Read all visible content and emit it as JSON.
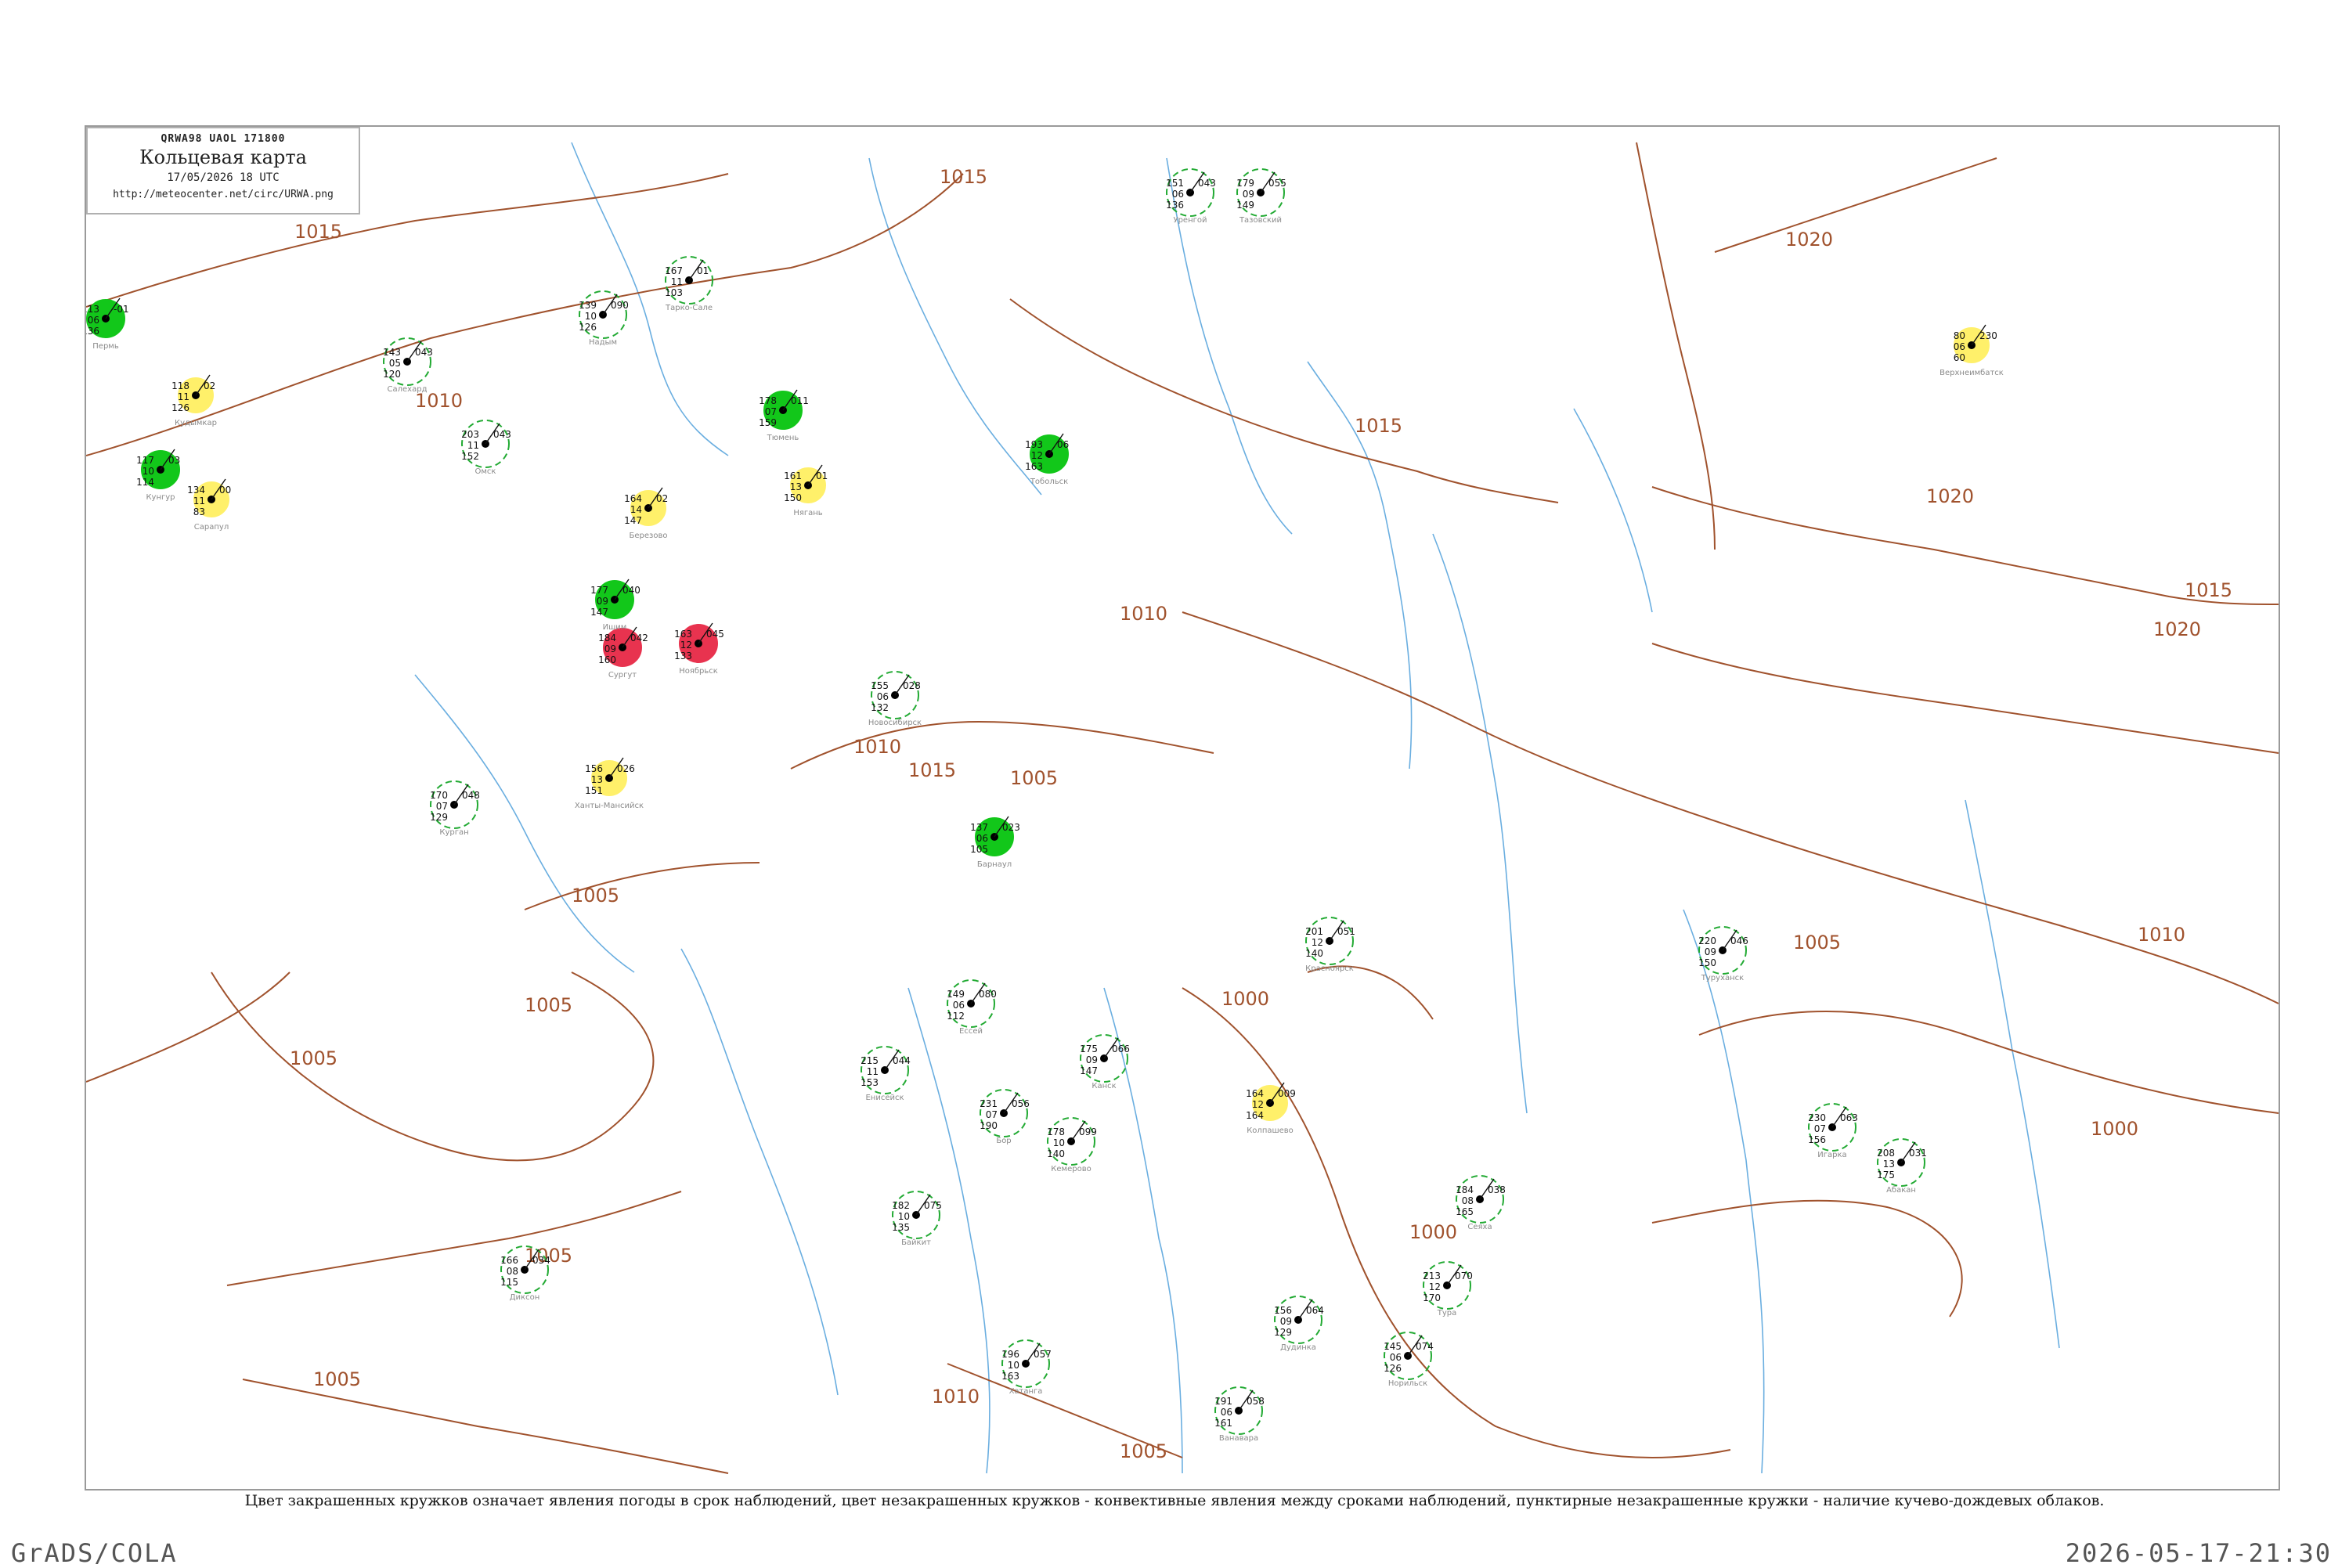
{
  "header": {
    "bulletin": "QRWA98  UAOL  171800",
    "title": "Кольцевая карта",
    "datetime": "17/05/2026 18 UTC",
    "url": "http://meteocenter.net/circ/URWA.png"
  },
  "legend_note": "Цвет закрашенных кружков означает явления погоды в срок наблюдений, цвет незакрашенных кружков - конвективные явления между сроками наблюдений, пунктирные незакрашенные кружки - наличие кучево-дождевых облаков.",
  "footer": {
    "software": "GrADS/COLA",
    "timestamp": "2026-05-17-21:30"
  },
  "colors": {
    "isobar": "#a0522d",
    "river": "#6aaee0",
    "filled_green": "#12c71a",
    "filled_red": "#e8334f",
    "filled_yellow": "#fff06a",
    "ring_green": "#22aa33",
    "ring_red": "#d23a5a",
    "station_text": "#111111",
    "station_name": "#8a8a8a"
  },
  "isobar_labels": [
    {
      "text": "1015"
    },
    {
      "text": "1010"
    },
    {
      "text": "1015"
    },
    {
      "text": "1020"
    },
    {
      "text": "1015"
    },
    {
      "text": "1020"
    },
    {
      "text": "1020"
    },
    {
      "text": "1015"
    },
    {
      "text": "1010"
    },
    {
      "text": "1005"
    },
    {
      "text": "1005"
    },
    {
      "text": "1010"
    },
    {
      "text": "1015"
    },
    {
      "text": "1010"
    },
    {
      "text": "1005"
    },
    {
      "text": "1005"
    },
    {
      "text": "1000"
    },
    {
      "text": "1005"
    },
    {
      "text": "1005"
    },
    {
      "text": "1000"
    },
    {
      "text": "1000"
    },
    {
      "text": "1005"
    },
    {
      "text": "1010"
    },
    {
      "text": "1005"
    }
  ],
  "stations": [
    {
      "t": "113",
      "d": "06",
      "p": "136",
      "c": "-01",
      "name": "Пермь",
      "fill": "green"
    },
    {
      "t": "118",
      "d": "11",
      "p": "126",
      "c": "02",
      "name": "Кудымкар",
      "fill": "yellow"
    },
    {
      "t": "117",
      "d": "10",
      "p": "114",
      "c": "03",
      "name": "Кунгур",
      "fill": "green"
    },
    {
      "t": "134",
      "d": "11",
      "p": "83",
      "c": "00",
      "name": "Сарапул",
      "fill": "yellow"
    },
    {
      "t": "161",
      "d": "13",
      "p": "150",
      "c": "01",
      "name": "Нягань",
      "fill": "yellow"
    },
    {
      "t": "164",
      "d": "14",
      "p": "147",
      "c": "02",
      "name": "Березово",
      "fill": "yellow"
    },
    {
      "t": "156",
      "d": "13",
      "p": "151",
      "c": "026",
      "name": "Ханты-Мансийск",
      "fill": "yellow"
    },
    {
      "t": "164",
      "d": "12",
      "p": "164",
      "c": "009",
      "name": "Колпашево",
      "fill": "yellow"
    },
    {
      "t": "80",
      "d": "06",
      "p": "60",
      "c": "230",
      "name": "Верхнеимбатск",
      "fill": "yellow"
    },
    {
      "t": "184",
      "d": "09",
      "p": "160",
      "c": "042",
      "name": "Сургут",
      "fill": "red"
    },
    {
      "t": "163",
      "d": "12",
      "p": "133",
      "c": "045",
      "name": "Ноябрьск",
      "fill": "red"
    },
    {
      "t": "139",
      "d": "10",
      "p": "126",
      "c": "090",
      "name": "Надым",
      "fill": "ring"
    },
    {
      "t": "167",
      "d": "11",
      "p": "103",
      "c": "01",
      "name": "Тарко-Сале",
      "fill": "ring"
    },
    {
      "t": "193",
      "d": "12",
      "p": "163",
      "c": "06",
      "name": "Тобольск",
      "fill": "green"
    },
    {
      "t": "178",
      "d": "07",
      "p": "159",
      "c": "011",
      "name": "Тюмень",
      "fill": "green"
    },
    {
      "t": "203",
      "d": "11",
      "p": "152",
      "c": "043",
      "name": "Омск",
      "fill": "ring"
    },
    {
      "t": "177",
      "d": "09",
      "p": "147",
      "c": "040",
      "name": "Ишим",
      "fill": "green"
    },
    {
      "t": "170",
      "d": "07",
      "p": "129",
      "c": "048",
      "name": "Курган",
      "fill": "ring"
    },
    {
      "t": "155",
      "d": "06",
      "p": "132",
      "c": "028",
      "name": "Новосибирск",
      "fill": "ring"
    },
    {
      "t": "137",
      "d": "06",
      "p": "105",
      "c": "023",
      "name": "Барнаул",
      "fill": "green"
    },
    {
      "t": "178",
      "d": "10",
      "p": "140",
      "c": "099",
      "name": "Кемерово",
      "fill": "ring"
    },
    {
      "t": "208",
      "d": "13",
      "p": "175",
      "c": "031",
      "name": "Абакан",
      "fill": "ring"
    },
    {
      "t": "201",
      "d": "12",
      "p": "140",
      "c": "051",
      "name": "Красноярск",
      "fill": "ring"
    },
    {
      "t": "175",
      "d": "09",
      "p": "147",
      "c": "066",
      "name": "Канск",
      "fill": "ring"
    },
    {
      "t": "215",
      "d": "11",
      "p": "153",
      "c": "044",
      "name": "Енисейск",
      "fill": "ring"
    },
    {
      "t": "231",
      "d": "07",
      "p": "190",
      "c": "056",
      "name": "Бор",
      "fill": "ring"
    },
    {
      "t": "220",
      "d": "09",
      "p": "150",
      "c": "046",
      "name": "Туруханск",
      "fill": "ring"
    },
    {
      "t": "230",
      "d": "07",
      "p": "156",
      "c": "063",
      "name": "Игарка",
      "fill": "ring"
    },
    {
      "t": "156",
      "d": "09",
      "p": "129",
      "c": "064",
      "name": "Дудинка",
      "fill": "ring"
    },
    {
      "t": "145",
      "d": "06",
      "p": "126",
      "c": "074",
      "name": "Норильск",
      "fill": "ring"
    },
    {
      "t": "191",
      "d": "06",
      "p": "161",
      "c": "058",
      "name": "Ванавара",
      "fill": "ring"
    },
    {
      "t": "213",
      "d": "12",
      "p": "170",
      "c": "070",
      "name": "Тура",
      "fill": "ring"
    },
    {
      "t": "182",
      "d": "10",
      "p": "135",
      "c": "075",
      "name": "Байкит",
      "fill": "ring"
    },
    {
      "t": "149",
      "d": "06",
      "p": "112",
      "c": "080",
      "name": "Ессей",
      "fill": "ring"
    },
    {
      "t": "196",
      "d": "10",
      "p": "163",
      "c": "057",
      "name": "Хатанга",
      "fill": "ring"
    },
    {
      "t": "166",
      "d": "08",
      "p": "115",
      "c": "034",
      "name": "Диксон",
      "fill": "ring"
    },
    {
      "t": "143",
      "d": "05",
      "p": "120",
      "c": "043",
      "name": "Салехард",
      "fill": "ring"
    },
    {
      "t": "151",
      "d": "06",
      "p": "136",
      "c": "043",
      "name": "Уренгой",
      "fill": "ring"
    },
    {
      "t": "179",
      "d": "09",
      "p": "149",
      "c": "055",
      "name": "Тазовский",
      "fill": "ring"
    },
    {
      "t": "184",
      "d": "08",
      "p": "165",
      "c": "038",
      "name": "Сеяха",
      "fill": "ring"
    }
  ]
}
